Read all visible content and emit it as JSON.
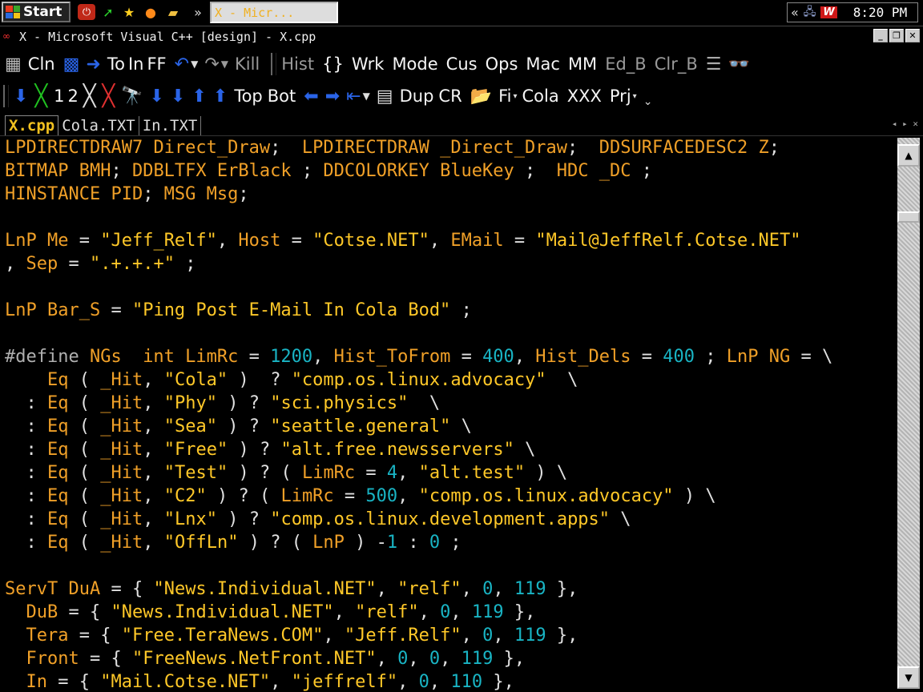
{
  "taskbar": {
    "start_label": "Start",
    "task_button_label": "X - Micr...",
    "clock": "8:20 PM",
    "tray_chevron": "«",
    "overflow_chevron": "»"
  },
  "window": {
    "title": "X - Microsoft Visual C++ [design] - X.cpp"
  },
  "toolbar1": {
    "cln": "Cln",
    "to": "To",
    "in": "In",
    "ff": "FF",
    "kill": "Kill",
    "hist": "Hist",
    "braces": "{}",
    "wrk": "Wrk",
    "mode": "Mode",
    "cus": "Cus",
    "ops": "Ops",
    "mac": "Mac",
    "mm": "MM",
    "ed_b": "Ed_B",
    "clr_b": "Clr_B"
  },
  "toolbar2": {
    "one": "1",
    "two": "2",
    "top": "Top",
    "bot": "Bot",
    "dup": "Dup",
    "cr": "CR",
    "fi": "Fi",
    "cola": "Cola",
    "xxx": "XXX",
    "prj": "Prj"
  },
  "tabs": [
    {
      "label": "X.cpp",
      "active": true
    },
    {
      "label": "Cola.TXT",
      "active": false
    },
    {
      "label": "In.TXT",
      "active": false
    }
  ],
  "code_lines": [
    "LPDIRECTDRAW7 Direct_Draw;  LPDIRECTDRAW _Direct_Draw;  DDSURFACEDESC2 Z;",
    "BITMAP BMH; DDBLTFX ErBlack ; DDCOLORKEY BlueKey ;  HDC _DC ;",
    "HINSTANCE PID; MSG Msg;",
    "",
    "LnP Me = \"Jeff_Relf\", Host = \"Cotse.NET\", EMail = \"Mail@JeffRelf.Cotse.NET\"",
    ", Sep = \".+.+.+\" ;",
    "",
    "LnP Bar_S = \"Ping Post E-Mail In Cola Bod\" ;",
    "",
    "#define NGs  int LimRc = 1200, Hist_ToFrom = 400, Hist_Dels = 400 ; LnP NG = \\",
    "    Eq ( _Hit, \"Cola\" )  ? \"comp.os.linux.advocacy\"  \\",
    "  : Eq ( _Hit, \"Phy\" ) ? \"sci.physics\"  \\",
    "  : Eq ( _Hit, \"Sea\" ) ? \"seattle.general\" \\",
    "  : Eq ( _Hit, \"Free\" ) ? \"alt.free.newsservers\" \\",
    "  : Eq ( _Hit, \"Test\" ) ? ( LimRc = 4, \"alt.test\" ) \\",
    "  : Eq ( _Hit, \"C2\" ) ? ( LimRc = 500, \"comp.os.linux.advocacy\" ) \\",
    "  : Eq ( _Hit, \"Lnx\" ) ? \"comp.os.linux.development.apps\" \\",
    "  : Eq ( _Hit, \"OffLn\" ) ? ( LnP ) -1 : 0 ;",
    "",
    "ServT DuA = { \"News.Individual.NET\", \"relf\", 0, 119 },",
    "  DuB = { \"News.Individual.NET\", \"relf\", 0, 119 },",
    "  Tera = { \"Free.TeraNews.COM\", \"Jeff.Relf\", 0, 119 },",
    "  Front = { \"FreeNews.NetFront.NET\", 0, 0, 119 },",
    "  In = { \"Mail.Cotse.NET\", \"jeffrelf\", 0, 110 },"
  ],
  "colors": {
    "keyword": "#f0a028",
    "string": "#ffc828",
    "number": "#19b4c4",
    "punct": "#e0e0e0"
  }
}
